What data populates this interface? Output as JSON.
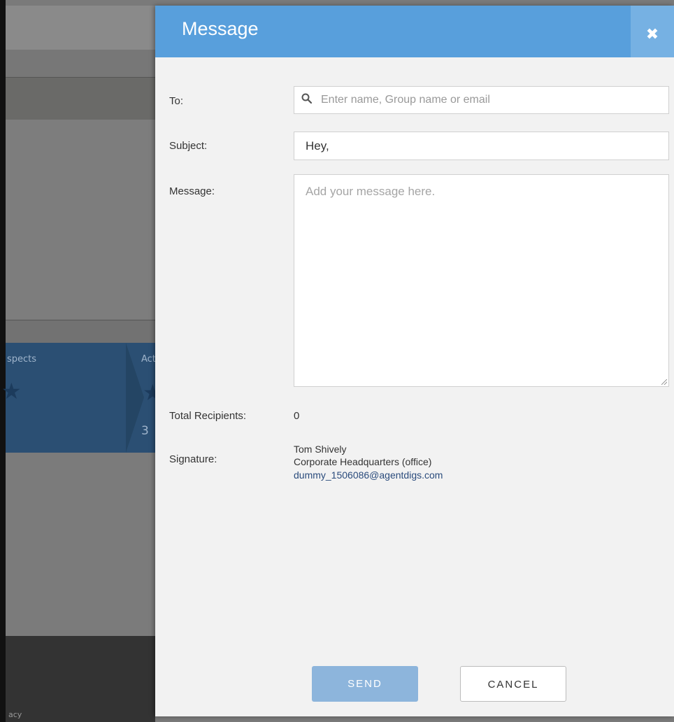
{
  "background": {
    "pipeline_label_left": "spects",
    "pipeline_label_right": "Act",
    "pipeline_count": "3",
    "footer_fragment": "acy"
  },
  "modal": {
    "title": "Message",
    "close_icon": "close-icon",
    "to": {
      "label": "To:",
      "placeholder": "Enter name, Group name or email",
      "icon": "search-icon"
    },
    "subject": {
      "label": "Subject:",
      "value": "Hey,"
    },
    "message": {
      "label": "Message:",
      "placeholder": "Add your message here."
    },
    "total_recipients": {
      "label": "Total Recipients:",
      "value": "0"
    },
    "signature": {
      "label": "Signature:",
      "name": "Tom Shively",
      "office": "Corporate Headquarters (office)",
      "email": "dummy_1506086@agentdigs.com"
    },
    "buttons": {
      "send": "SEND",
      "cancel": "CANCEL"
    },
    "colors": {
      "header": "#589fdc",
      "close_bg": "#76b1e3",
      "send_bg": "#8db5dc",
      "link": "#2a4b7c"
    }
  }
}
